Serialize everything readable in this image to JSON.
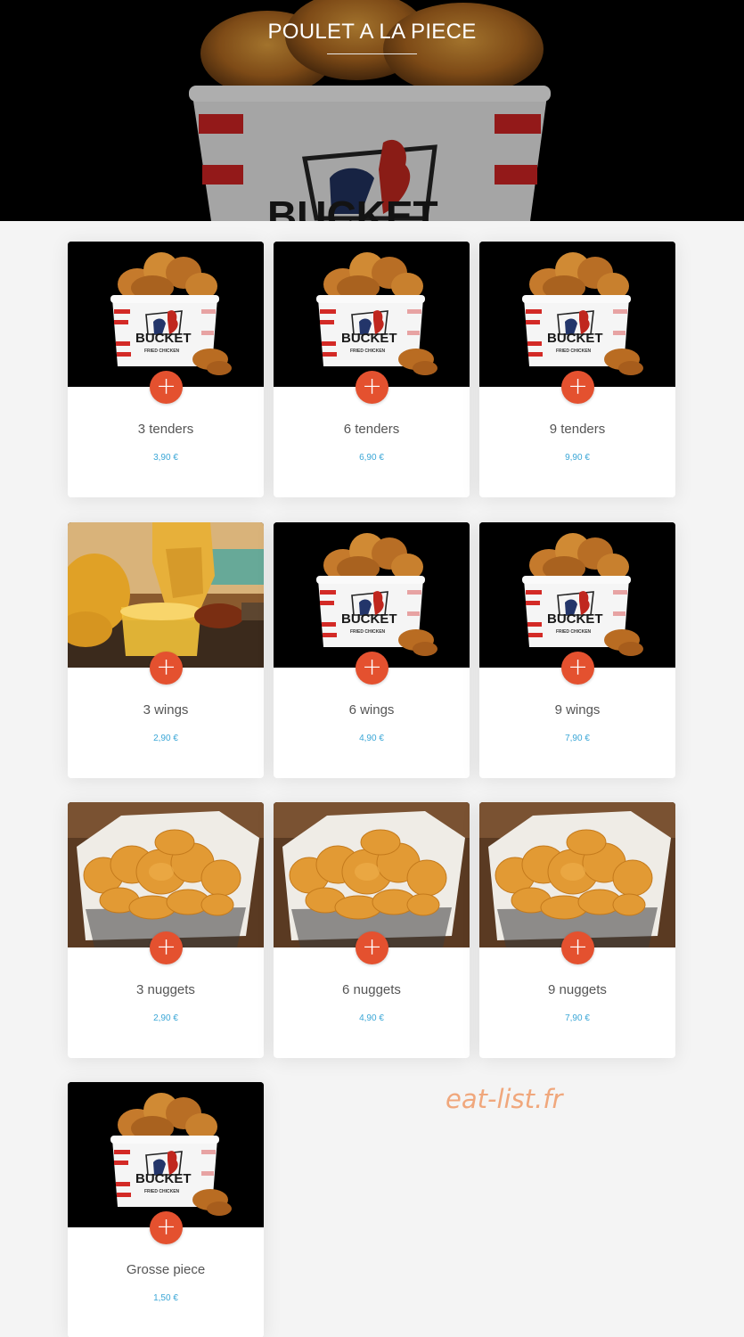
{
  "header": {
    "title": "POULET A LA PIECE"
  },
  "products": [
    {
      "name": "3 tenders",
      "price": "3,90 €",
      "image": "bucket-image"
    },
    {
      "name": "6 tenders",
      "price": "6,90 €",
      "image": "bucket-image"
    },
    {
      "name": "9 tenders",
      "price": "9,90 €",
      "image": "bucket-image"
    },
    {
      "name": "3 wings",
      "price": "2,90 €",
      "image": "wing-dip-image"
    },
    {
      "name": "6 wings",
      "price": "4,90 €",
      "image": "bucket-image"
    },
    {
      "name": "9 wings",
      "price": "7,90 €",
      "image": "bucket-image"
    },
    {
      "name": "3 nuggets",
      "price": "2,90 €",
      "image": "nuggets-basket-image"
    },
    {
      "name": "6 nuggets",
      "price": "4,90 €",
      "image": "nuggets-basket-image"
    },
    {
      "name": "9 nuggets",
      "price": "7,90 €",
      "image": "nuggets-basket-image"
    },
    {
      "name": "Grosse piece",
      "price": "1,50 €",
      "image": "bucket-image"
    }
  ],
  "add_label": "+",
  "bucket_logo": {
    "line1": "BUCKET",
    "line2": "FRIED CHICKEN"
  },
  "watermark": "eat-list.fr",
  "colors": {
    "accent": "#e4512f",
    "price": "#3aa6d6",
    "hero_bg": "#000000",
    "page_bg": "#f4f4f4"
  }
}
